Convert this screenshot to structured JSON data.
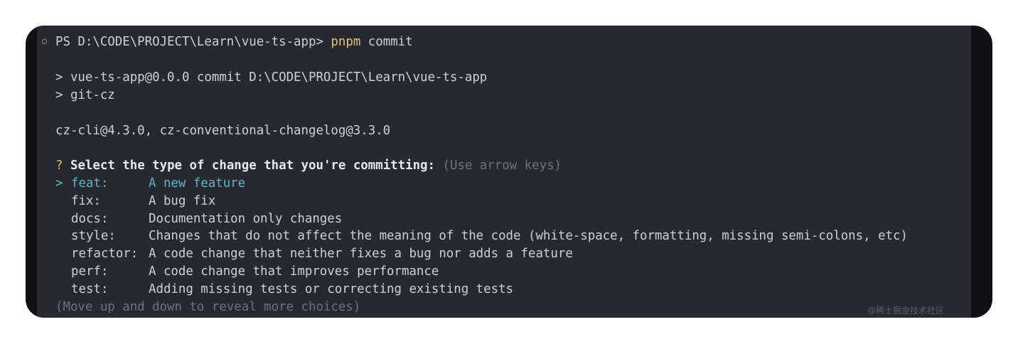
{
  "terminal": {
    "prompt": "PS D:\\CODE\\PROJECT\\Learn\\vue-ts-app>",
    "command_bin": "pnpm",
    "command_arg": "commit",
    "script_line1": "> vue-ts-app@0.0.0 commit D:\\CODE\\PROJECT\\Learn\\vue-ts-app",
    "script_line2": "> git-cz",
    "version_line": "cz-cli@4.3.0, cz-conventional-changelog@3.3.0",
    "question_mark": "?",
    "question": "Select the type of change that you're committing:",
    "hint": "(Use arrow keys)",
    "choices": [
      {
        "pointer": ">",
        "key": "feat:",
        "desc": "A new feature",
        "selected": true
      },
      {
        "pointer": "",
        "key": "fix:",
        "desc": "A bug fix",
        "selected": false
      },
      {
        "pointer": "",
        "key": "docs:",
        "desc": "Documentation only changes",
        "selected": false
      },
      {
        "pointer": "",
        "key": "style:",
        "desc": "Changes that do not affect the meaning of the code (white-space, formatting, missing semi-colons, etc)",
        "selected": false
      },
      {
        "pointer": "",
        "key": "refactor:",
        "desc": "A code change that neither fixes a bug nor adds a feature",
        "selected": false
      },
      {
        "pointer": "",
        "key": "perf:",
        "desc": "A code change that improves performance",
        "selected": false
      },
      {
        "pointer": "",
        "key": "test:",
        "desc": "Adding missing tests or correcting existing tests",
        "selected": false
      }
    ],
    "more_hint": "(Move up and down to reveal more choices)"
  },
  "watermark": "@稀土掘金技术社区"
}
